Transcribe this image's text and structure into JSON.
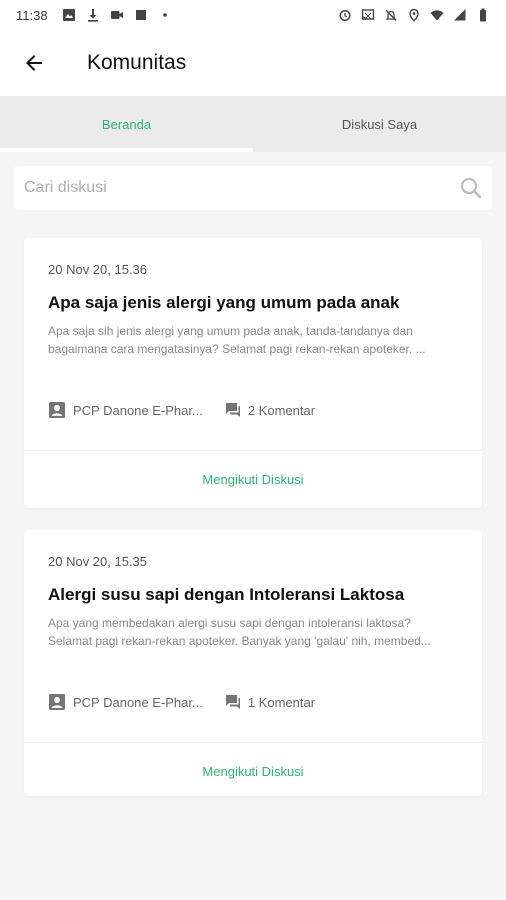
{
  "status_bar": {
    "time": "11:38",
    "left_icons": [
      "image-icon",
      "download-icon",
      "video-icon",
      "stop-icon",
      "dot-icon"
    ],
    "right_icons": [
      "alarm-icon",
      "cast-icon",
      "notifications-off-icon",
      "location-icon",
      "wifi-icon",
      "signal-icon",
      "battery-icon"
    ]
  },
  "app_bar": {
    "title": "Komunitas",
    "back_icon": "arrow-left-icon"
  },
  "tabs": [
    {
      "label": "Beranda",
      "active": true
    },
    {
      "label": "Diskusi Saya",
      "active": false
    }
  ],
  "search": {
    "placeholder": "Cari diskusi",
    "value": "",
    "icon": "search-icon"
  },
  "discussions": [
    {
      "date": "20 Nov 20, 15.36",
      "title": "Apa saja jenis alergi yang umum pada anak",
      "excerpt_line1": "Apa saja sih jenis alergi yang umum pada anak, tanda-tandanya dan",
      "excerpt_line2": "bagaimana cara mengatasinya? Selamat pagi rekan-rekan apoteker. ...",
      "author": "PCP Danone E-Phar...",
      "comments": "2 Komentar",
      "follow_label": "Mengikuti Diskusi"
    },
    {
      "date": "20 Nov 20, 15.35",
      "title": "Alergi susu sapi dengan Intoleransi Laktosa",
      "excerpt_line1": "Apa yang membedakan alergi susu sapi dengan intoleransi laktosa?",
      "excerpt_line2": "Selamat pagi rekan-rekan apoteker. Banyak yang 'galau' nih, membed...",
      "author": "PCP Danone E-Phar...",
      "comments": "1 Komentar",
      "follow_label": "Mengikuti Diskusi"
    }
  ],
  "colors": {
    "accent": "#2bb673",
    "background": "#f5f5f5",
    "tab_bar": "#ebebeb"
  }
}
